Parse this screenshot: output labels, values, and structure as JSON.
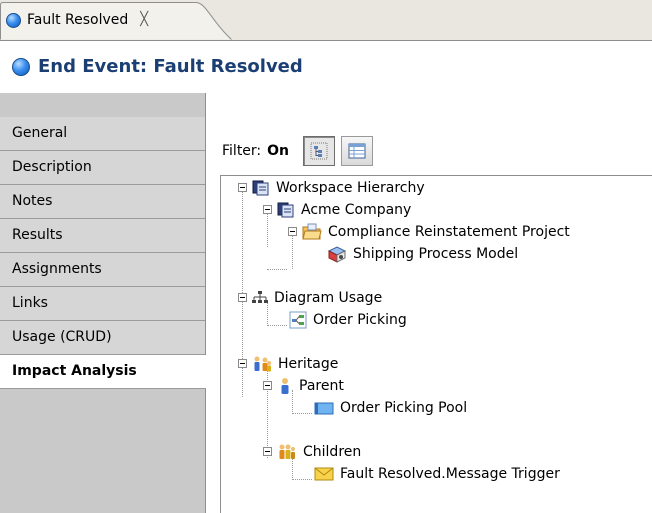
{
  "tab": {
    "title": "Fault Resolved",
    "close_glyph": "╳"
  },
  "header": {
    "title": "End Event: Fault Resolved"
  },
  "sidebar": {
    "items": [
      {
        "label": "General"
      },
      {
        "label": "Description"
      },
      {
        "label": "Notes"
      },
      {
        "label": "Results"
      },
      {
        "label": "Assignments"
      },
      {
        "label": "Links"
      },
      {
        "label": "Usage (CRUD)"
      },
      {
        "label": "Impact Analysis",
        "active": true
      }
    ]
  },
  "filter": {
    "label": "Filter:",
    "state": "On"
  },
  "tree": {
    "workspace_hierarchy": "Workspace Hierarchy",
    "acme_company": "Acme Company",
    "compliance_project": "Compliance Reinstatement Project",
    "shipping_model": "Shipping Process Model",
    "diagram_usage": "Diagram Usage",
    "order_picking": "Order Picking",
    "heritage": "Heritage",
    "parent": "Parent",
    "order_picking_pool": "Order Picking Pool",
    "children": "Children",
    "message_trigger": "Fault Resolved.Message Trigger"
  },
  "colors": {
    "accent": "#1b3f73",
    "sidebar_bg": "#c9c9c9",
    "tabbar_bg": "#e9e7df"
  }
}
